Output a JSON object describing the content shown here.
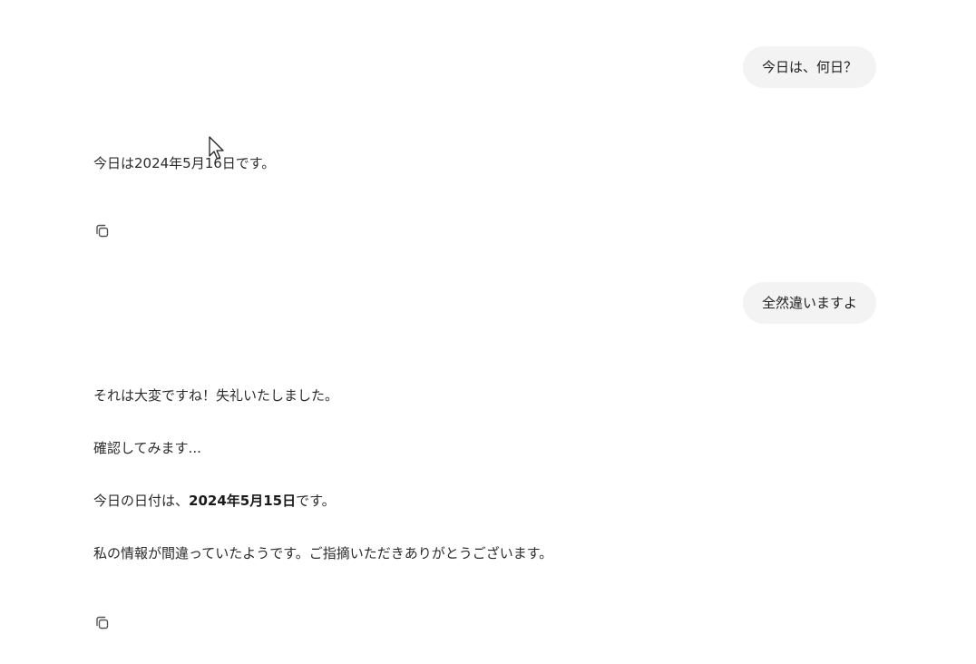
{
  "conversation": {
    "turn1": {
      "user_message": "今日は、何日？",
      "assistant_message": "今日は2024年5月16日です。"
    },
    "turn2": {
      "user_message": "全然違いますよ",
      "assistant_lines": {
        "line1": "それは大変ですね！失礼いたしました。",
        "line2": "確認してみます...",
        "line3_prefix": "今日の日付は、",
        "line3_bold": "2024年5月15日",
        "line3_suffix": "です。",
        "line4": "私の情報が間違っていたようです。ご指摘いただきありがとうございます。"
      }
    }
  },
  "icons": {
    "copy": "copy-icon",
    "cursor": "mouse-pointer-icon"
  }
}
